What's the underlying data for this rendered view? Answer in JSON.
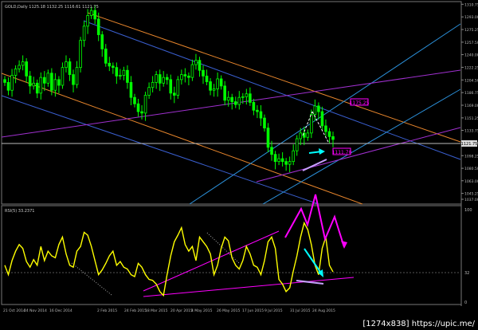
{
  "chart_data": [
    {
      "type": "candlestick",
      "title": "GOLD,Daily  1125.18 1132.25 1116.61 1121.75",
      "instrument": "GOLD",
      "timeframe": "Daily",
      "ohlc_header": {
        "open": 1125.18,
        "high": 1132.25,
        "low": 1116.61,
        "close": 1121.75
      },
      "current_price_label": "1121.75",
      "ylim": [
        1037,
        1310
      ],
      "y_ticks": [
        "1310.75",
        "1293.00",
        "1275.25",
        "1257.50",
        "1240.00",
        "1222.25",
        "1204.50",
        "1186.75",
        "1169.00",
        "1151.25",
        "1133.75",
        "1116.00",
        "1098.25",
        "1080.50",
        "1063.00",
        "1045.25",
        "1037.00"
      ],
      "annotations": [
        {
          "label": "1175.25",
          "color": "#ff00ff"
        },
        {
          "label": "1111.70",
          "color": "#ff00ff"
        }
      ],
      "colors": {
        "up": "#00ff00",
        "down": "#00ff00",
        "orange_channel": "#e8862c",
        "blue_lines": "#3a5fd0",
        "cyan_lines": "#2b8fd8",
        "purple_lines": "#a030d0",
        "price_line": "#c0c0c0",
        "arrows": "#00ffff",
        "magenta": "#ff00ff"
      },
      "close_path": [
        1201,
        1190,
        1211,
        1220,
        1225,
        1230,
        1210,
        1196,
        1200,
        1186,
        1208,
        1200,
        1214,
        1190,
        1205,
        1197,
        1222,
        1230,
        1212,
        1198,
        1222,
        1260,
        1280,
        1295,
        1302,
        1290,
        1268,
        1248,
        1228,
        1224,
        1222,
        1210,
        1211,
        1218,
        1201,
        1180,
        1171,
        1160,
        1158,
        1183,
        1194,
        1201,
        1212,
        1200,
        1208,
        1205,
        1186,
        1183,
        1205,
        1212,
        1210,
        1208,
        1226,
        1232,
        1218,
        1210,
        1202,
        1190,
        1192,
        1206,
        1196,
        1176,
        1180,
        1174,
        1170,
        1180,
        1181,
        1185,
        1173,
        1162,
        1160,
        1151,
        1137,
        1110,
        1100,
        1090,
        1094,
        1090,
        1086,
        1090,
        1105,
        1122,
        1130,
        1124,
        1130,
        1156,
        1168,
        1160,
        1140,
        1132,
        1125,
        1121
      ]
    },
    {
      "type": "line",
      "title": "RSI(5) 33.2371",
      "indicator": "RSI",
      "period": 5,
      "current_value": 33.2371,
      "ylim": [
        0,
        100
      ],
      "y_ticks": [
        "100",
        "32",
        "0"
      ],
      "series": [
        {
          "name": "RSI(5)",
          "color": "#ffff00",
          "values": [
            40,
            30,
            45,
            55,
            62,
            58,
            44,
            38,
            46,
            40,
            60,
            45,
            55,
            50,
            48,
            62,
            70,
            52,
            40,
            38,
            55,
            60,
            75,
            72,
            60,
            45,
            30,
            35,
            42,
            50,
            55,
            40,
            44,
            38,
            36,
            30,
            28,
            42,
            38,
            30,
            25,
            24,
            20,
            12,
            8,
            30,
            50,
            65,
            72,
            80,
            62,
            55,
            60,
            45,
            70,
            65,
            60,
            52,
            30,
            40,
            58,
            70,
            66,
            48,
            40,
            36,
            45,
            60,
            52,
            40,
            38,
            30,
            45,
            65,
            70,
            58,
            25,
            20,
            12,
            16,
            34,
            50,
            70,
            85,
            78,
            62,
            40,
            30,
            58,
            70,
            40,
            33
          ]
        }
      ],
      "annotations": [
        {
          "type": "arrow",
          "color": "#ff00ff",
          "description": "zigzag above peaks"
        },
        {
          "type": "arrow",
          "color": "#00ffff",
          "description": "arrow down"
        }
      ]
    }
  ],
  "x_axis": {
    "labels": [
      "21 Oct 2014",
      "24 Nov 2014",
      "16 Dec 2014",
      "2 Feb 2015",
      "24 Feb 2015",
      "18 Mar 2015",
      "20 Apr 2015",
      "4 May 2015",
      "26 May 2015",
      "17 Jun 2015",
      "9 Jul 2015",
      "31 Jul 2015",
      "24 Aug 2015"
    ]
  },
  "watermark": "[1274x838] https://upic.me/"
}
